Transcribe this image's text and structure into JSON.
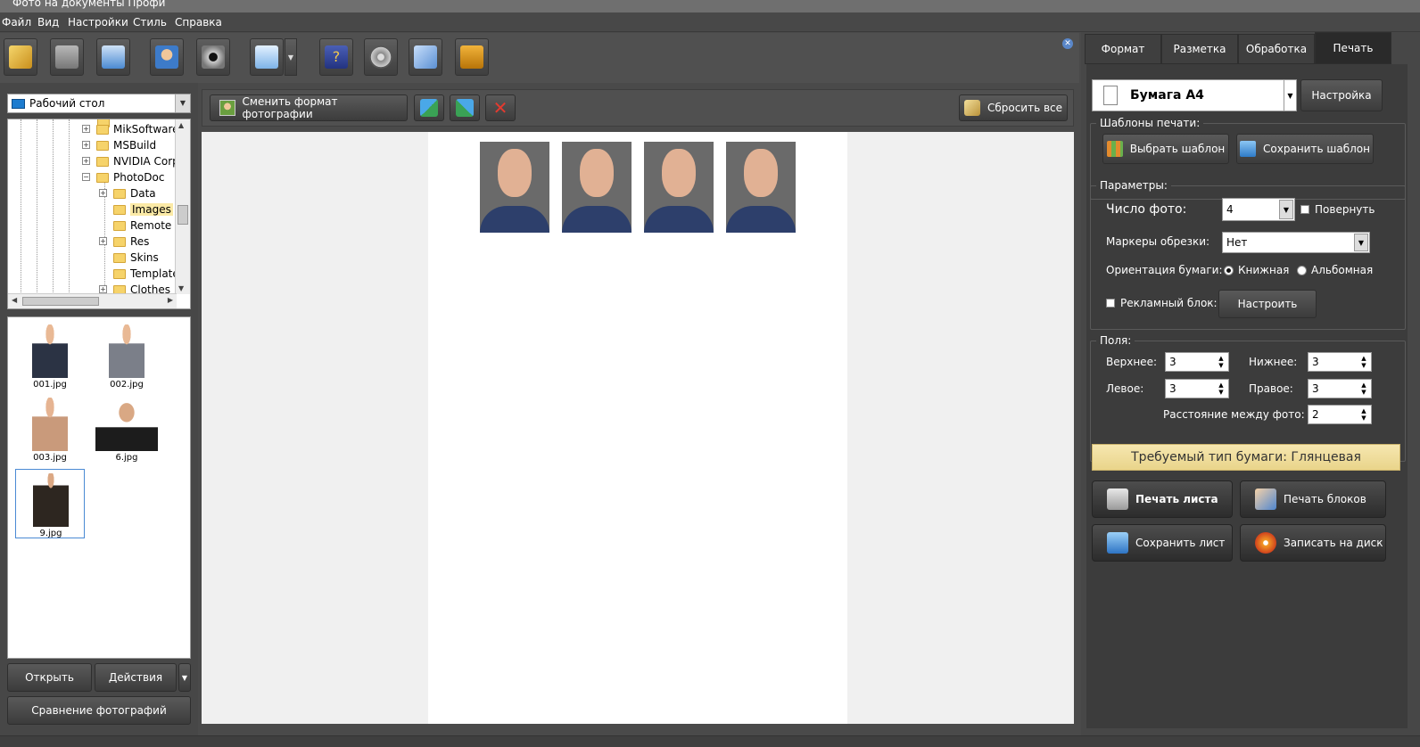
{
  "window": {
    "title": "Фото на документы Профи"
  },
  "menu": [
    "Файл",
    "Вид",
    "Настройки",
    "Стиль",
    "Справка"
  ],
  "toolbar": {
    "icons": [
      "open-folder-icon",
      "save-icon",
      "print-icon",
      "user-photo-icon",
      "camera-icon",
      "screen-icon",
      "help-book-icon",
      "film-icon",
      "package-icon",
      "cart-icon"
    ]
  },
  "folder_dropdown": {
    "value": "Рабочий стол"
  },
  "tree": [
    "MikSoftware",
    "MSBuild",
    "NVIDIA Corp",
    "PhotoDoc",
    "Data",
    "Images",
    "Remote",
    "Res",
    "Skins",
    "Template",
    "Clothes"
  ],
  "thumbnails": [
    "001.jpg",
    "002.jpg",
    "003.jpg",
    "6.jpg",
    "9.jpg"
  ],
  "left_buttons": {
    "open": "Открыть",
    "actions": "Действия",
    "compare": "Сравнение фотографий"
  },
  "center_toolbar": {
    "change_format": "Сменить формат фотографии",
    "reset_all": "Сбросить все"
  },
  "page": {
    "photo_count": 4
  },
  "tabs": [
    "Формат",
    "Разметка",
    "Обработка",
    "Печать"
  ],
  "print": {
    "paper": "Бумага А4",
    "settings_btn": "Настройка",
    "templates_title": "Шаблоны печати:",
    "choose_template": "Выбрать шаблон",
    "save_template": "Сохранить шаблон",
    "params_title": "Параметры:",
    "photo_count_label": "Число фото:",
    "photo_count_value": "4",
    "rotate_label": "Повернуть",
    "crop_markers_label": "Маркеры обрезки:",
    "crop_markers_value": "Нет",
    "orientation_label": "Ориентация бумаги:",
    "portrait": "Книжная",
    "landscape": "Альбомная",
    "ad_block_label": "Рекламный блок:",
    "ad_configure": "Настроить",
    "margins_title": "Поля:",
    "top_label": "Верхнее:",
    "top_value": "3",
    "bottom_label": "Нижнее:",
    "bottom_value": "3",
    "left_label": "Левое:",
    "left_value": "3",
    "right_label": "Правое:",
    "right_value": "3",
    "spacing_label": "Расстояние между фото:",
    "spacing_value": "2",
    "paper_type_banner": "Требуемый тип бумаги: Глянцевая",
    "print_sheet": "Печать листа",
    "print_blocks": "Печать блоков",
    "save_sheet": "Сохранить лист",
    "burn_disc": "Записать на диск"
  }
}
